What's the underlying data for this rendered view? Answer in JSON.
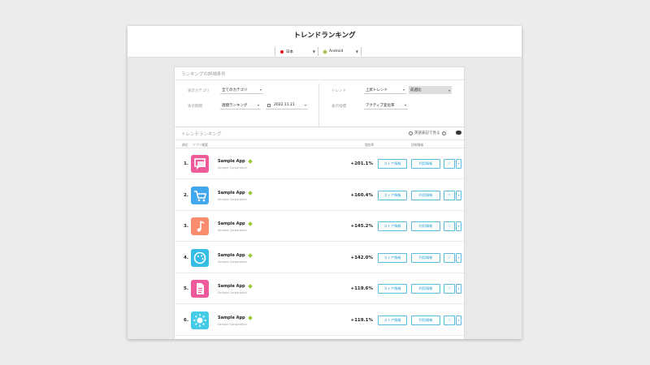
{
  "header": {
    "title": "トレンドランキング",
    "country": "日本",
    "os": "Android"
  },
  "conditions": {
    "title": "ランキングの詳細条件",
    "category_label": "表示カテゴリ",
    "category_value": "全てのカテゴリ",
    "period_label": "表示期間",
    "period_value": "週間ランキング",
    "date_value": "2022.11.21",
    "trend_label": "トレンド",
    "trend_value": "上昇トレンド",
    "compare_value": "前週比",
    "index_label": "表示指標",
    "index_value": "アクティブ変化率"
  },
  "ranking": {
    "title": "トレンドランキング",
    "english_toggle": "英語表記で見る",
    "col_rank": "順位",
    "col_app": "アプリ概要",
    "col_change": "増加率",
    "col_detail": "詳細情報",
    "store_btn": "ストア情報",
    "usage_btn": "利用情報",
    "star_icon": "☆",
    "drop_icon": "▾",
    "rows": [
      {
        "rank": "1.",
        "name": "Sample App",
        "dev": "Sample Corporation",
        "change": "+201.1%",
        "icon": "chat-icon",
        "color": "#ee5b9a"
      },
      {
        "rank": "2.",
        "name": "Sample App",
        "dev": "Sample Corporation",
        "change": "+160.4%",
        "icon": "cart-icon",
        "color": "#3fa8ee"
      },
      {
        "rank": "3.",
        "name": "Sample App",
        "dev": "Sample Corporation",
        "change": "+145.2%",
        "icon": "music-icon",
        "color": "#f98c6e"
      },
      {
        "rank": "4.",
        "name": "Sample App",
        "dev": "Sample Corporation",
        "change": "+142.0%",
        "icon": "palette-icon",
        "color": "#35bde6"
      },
      {
        "rank": "5.",
        "name": "Sample App",
        "dev": "Sample Corporation",
        "change": "+119.6%",
        "icon": "document-icon",
        "color": "#ef5a9c"
      },
      {
        "rank": "6.",
        "name": "Sample App",
        "dev": "Sample Corporation",
        "change": "+119.1%",
        "icon": "sun-icon",
        "color": "#43cbe8"
      }
    ]
  }
}
